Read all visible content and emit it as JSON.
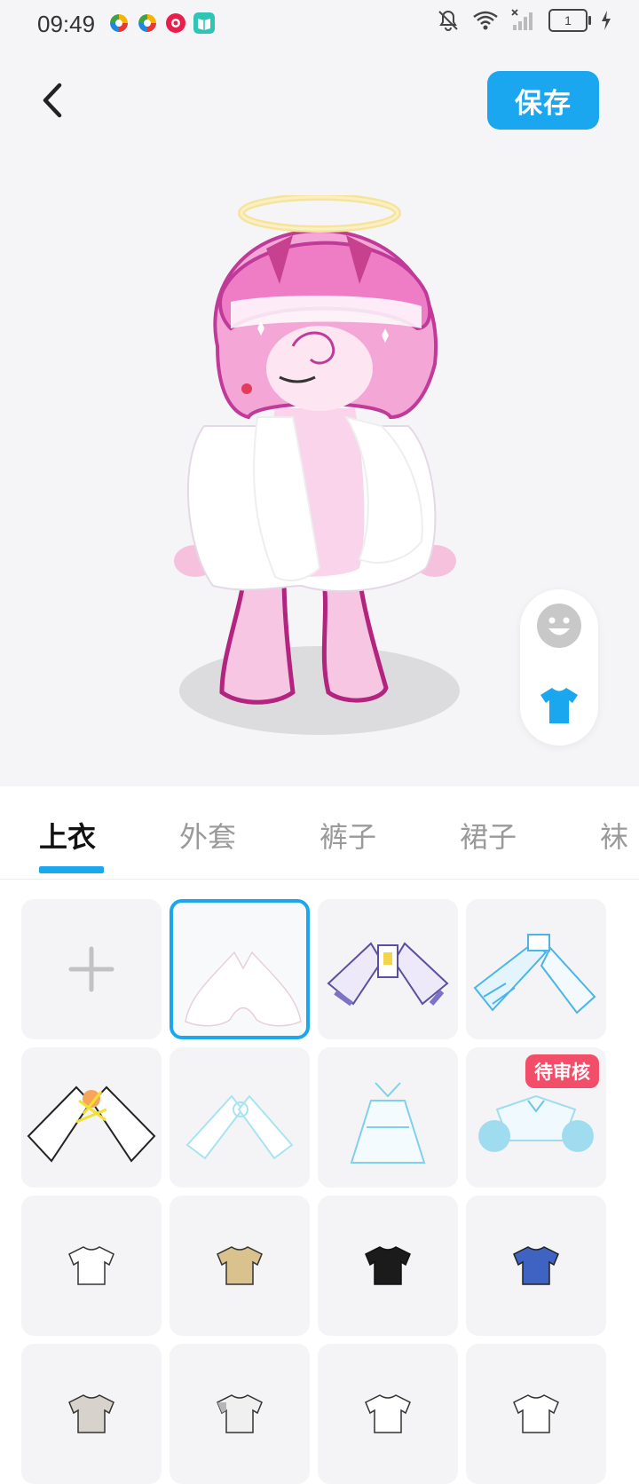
{
  "status_bar": {
    "time": "09:49",
    "battery_level": "1",
    "app_icons": [
      "app-icon-colorful",
      "app-icon-colorful",
      "app-icon-red-play",
      "app-icon-book"
    ],
    "system_icons": [
      "mute-icon",
      "wifi-icon",
      "signal-icon",
      "battery-icon",
      "charging-icon"
    ]
  },
  "header": {
    "back_icon": "chevron-left-icon",
    "save_label": "保存"
  },
  "toggle": {
    "face_icon": "smiley-face-icon",
    "clothes_icon": "tshirt-icon",
    "active": "clothes"
  },
  "tabs": [
    {
      "label": "上衣",
      "active": true
    },
    {
      "label": "外套",
      "active": false
    },
    {
      "label": "裤子",
      "active": false
    },
    {
      "label": "裙子",
      "active": false
    },
    {
      "label": "袜",
      "active": false
    }
  ],
  "items": [
    {
      "type": "add",
      "icon": "plus-icon"
    },
    {
      "type": "clothing",
      "name": "white-sleeves",
      "selected": true
    },
    {
      "type": "clothing",
      "name": "lavender-sleeves"
    },
    {
      "type": "clothing",
      "name": "blue-sleeves"
    },
    {
      "type": "clothing",
      "name": "black-outline-sleeves"
    },
    {
      "type": "clothing",
      "name": "light-blue-sleeves"
    },
    {
      "type": "clothing",
      "name": "light-blue-dress"
    },
    {
      "type": "clothing",
      "name": "cyan-puff-sleeves",
      "badge": "待审核"
    },
    {
      "type": "tshirt",
      "name": "white-tshirt",
      "color": "#ffffff"
    },
    {
      "type": "tshirt",
      "name": "beige-tshirt",
      "color": "#d9c28e"
    },
    {
      "type": "tshirt",
      "name": "black-tshirt",
      "color": "#1b1b1b"
    },
    {
      "type": "tshirt",
      "name": "blue-tshirt",
      "color": "#3f63c2"
    },
    {
      "type": "tshirt",
      "name": "gray-tshirt",
      "color": "#d8d2cc"
    },
    {
      "type": "tshirt",
      "name": "white-gray-tshirt",
      "color": "#f0f0f0"
    },
    {
      "type": "tshirt",
      "name": "white-tshirt-2",
      "color": "#ffffff"
    },
    {
      "type": "tshirt",
      "name": "white-tshirt-3",
      "color": "#ffffff"
    }
  ],
  "colors": {
    "accent": "#1aa7f0",
    "badge": "#f24e6a",
    "preview_bg": "#f5f5f7"
  }
}
